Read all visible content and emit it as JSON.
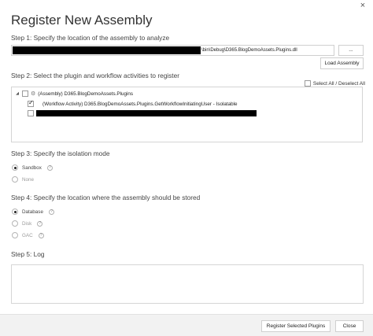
{
  "window": {
    "close_glyph": "×",
    "title": "Register New Assembly"
  },
  "step1": {
    "label": "Step 1: Specify the location of the assembly to analyze",
    "path_visible": "\\bin\\Debug\\D365.BlogDemoAssets.Plugins.dll",
    "browse_label": "...",
    "load_label": "Load Assembly"
  },
  "step2": {
    "label": "Step 2: Select the plugin and workflow activities to register",
    "select_all_label": "Select All / Deselect All",
    "tree": {
      "assembly_label": "(Assembly) D365.BlogDemoAssets.Plugins",
      "activity_label": "(Workflow Activity) D365.BlogDemoAssets.Plugins.GetWorkflowInitiatingUser - Isolatable"
    }
  },
  "step3": {
    "label": "Step 3: Specify the isolation mode",
    "options": [
      {
        "label": "Sandbox",
        "selected": true
      },
      {
        "label": "None",
        "selected": false
      }
    ]
  },
  "step4": {
    "label": "Step 4: Specify the location where the assembly should be stored",
    "options": [
      {
        "label": "Database",
        "selected": true
      },
      {
        "label": "Disk",
        "selected": false
      },
      {
        "label": "GAC",
        "selected": false
      }
    ]
  },
  "step5": {
    "label": "Step 5: Log"
  },
  "footer": {
    "register_label": "Register Selected Plugins",
    "close_label": "Close"
  },
  "icons": {
    "help": "?",
    "expand": "◢",
    "gear": "⚙"
  }
}
